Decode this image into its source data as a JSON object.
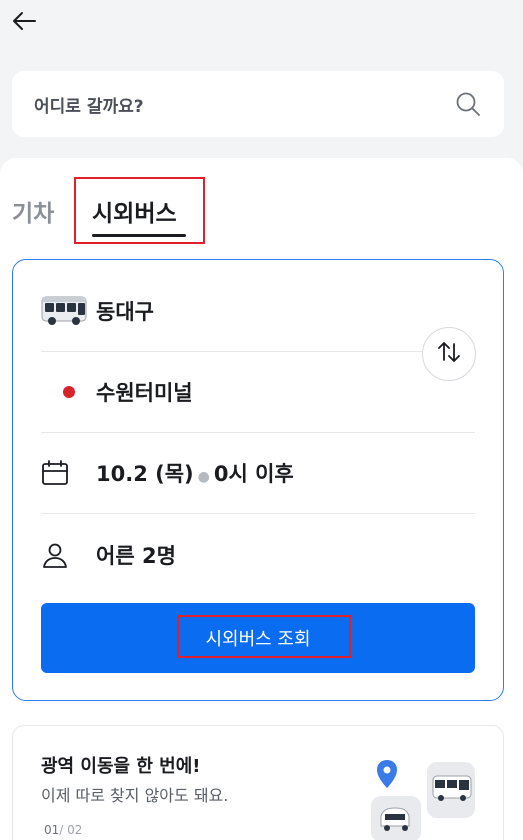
{
  "header": {
    "back_icon": "arrow-left-icon"
  },
  "search": {
    "placeholder": "어디로 갈까요?",
    "icon": "search-icon"
  },
  "tabs": [
    {
      "label": "기차",
      "active": false
    },
    {
      "label": "시외버스",
      "active": true
    }
  ],
  "form": {
    "departure": "동대구",
    "arrival": "수원터미널",
    "date": "10.2 (목)",
    "time": "0시 이후",
    "passengers": "어른 2명",
    "swap_icon": "swap-vertical-icon",
    "submit_label": "시외버스 조회"
  },
  "promo": {
    "title": "광역 이동을 한 번에!",
    "subtitle": "이제 따로 찾지 않아도 돼요.",
    "page_current": "01",
    "page_total": "/ 02"
  },
  "colors": {
    "accent": "#0a6cf0",
    "card_border": "#2b7ff0",
    "arrival_dot": "#d8232a",
    "highlight": "#e0202a"
  }
}
